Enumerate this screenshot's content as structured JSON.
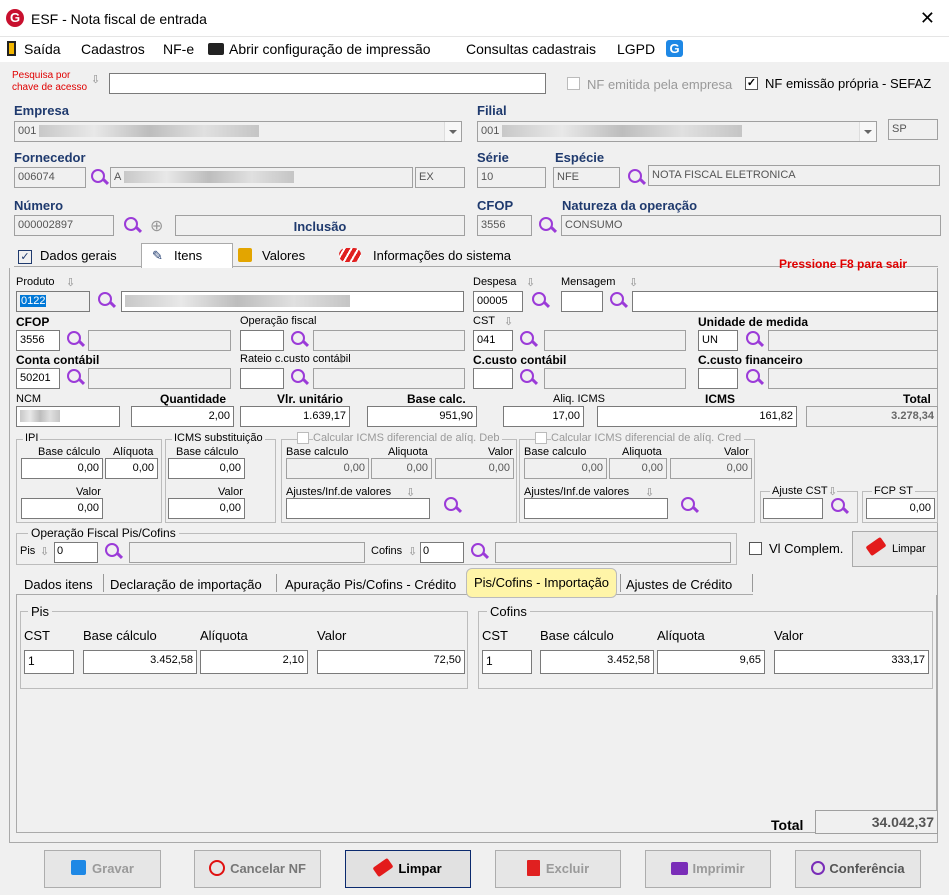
{
  "window": {
    "title": "ESF - Nota fiscal de entrada",
    "close": "✕",
    "app_icon": "G"
  },
  "menu": {
    "saida": "Saída",
    "cadastros": "Cadastros",
    "nfe": "NF-e",
    "abrir_config": "Abrir configuração de impressão",
    "consultas": "Consultas cadastrais",
    "lgpd": "LGPD"
  },
  "search": {
    "label_line1": "Pesquisa por",
    "label_line2": "chave de acesso",
    "value": ""
  },
  "flags": {
    "nf_emitida_label": "NF emitida pela empresa",
    "nf_emitida_checked": false,
    "nf_propria_label": "NF emissão própria - SEFAZ",
    "nf_propria_checked": true
  },
  "empresa": {
    "label": "Empresa",
    "code": "001"
  },
  "filial": {
    "label": "Filial",
    "code": "001",
    "uf": "SP"
  },
  "fornecedor": {
    "label": "Fornecedor",
    "code": "006074",
    "prefix": "A",
    "uf": "EX"
  },
  "serie": {
    "label": "Série",
    "value": "10"
  },
  "especie": {
    "label": "Espécie",
    "value": "NFE",
    "descricao": "NOTA FISCAL ELETRONICA"
  },
  "numero": {
    "label": "Número",
    "value": "000002897",
    "status": "Inclusão"
  },
  "cfop_head": {
    "label": "CFOP",
    "value": "3556"
  },
  "natureza": {
    "label": "Natureza da operação",
    "value": "CONSUMO"
  },
  "main_tabs": [
    {
      "label": "Dados gerais"
    },
    {
      "label": "Itens"
    },
    {
      "label": "Valores"
    },
    {
      "label": "Informações do sistema"
    }
  ],
  "hint": "Pressione F8 para sair",
  "item": {
    "produto_label": "Produto",
    "produto_code": "0122",
    "despesa_label": "Despesa",
    "despesa_value": "00005",
    "mensagem_label": "Mensagem",
    "mensagem_value": "",
    "cfop_label": "CFOP",
    "cfop_value": "3556",
    "operacao_label": "Operação fiscal",
    "operacao_value": "",
    "cst_label": "CST",
    "cst_value": "041",
    "unidade_label": "Unidade de medida",
    "unidade_value": "UN",
    "conta_label": "Conta contábil",
    "conta_value": "50201",
    "rateio_label": "Rateio c.custo contábil",
    "ccusto_label": "C.custo contábil",
    "ccusto_fin_label": "C.custo financeiro",
    "ncm_label": "NCM",
    "quantidade_label": "Quantidade",
    "quantidade_value": "2,00",
    "vlr_unit_label": "Vlr. unitário",
    "vlr_unit_value": "1.639,17",
    "base_label": "Base calc.",
    "base_value": "951,90",
    "aliq_icms_label": "Aliq. ICMS",
    "aliq_icms_value": "17,00",
    "icms_label": "ICMS",
    "icms_value": "161,82",
    "total_label": "Total",
    "total_value": "3.278,34"
  },
  "ipi": {
    "title": "IPI",
    "base_label": "Base cálculo",
    "base_value": "0,00",
    "aliq_label": "Alíquota",
    "aliq_value": "0,00",
    "valor_label": "Valor",
    "valor_value": "0,00"
  },
  "icms_st": {
    "title": "ICMS substituição",
    "base_label": "Base cálculo",
    "base_value": "0,00",
    "valor_label": "Valor",
    "valor_value": "0,00"
  },
  "difal_deb": {
    "title": "Calcular ICMS diferencial de alíq. Deb",
    "base_label": "Base calculo",
    "base_value": "0,00",
    "aliq_label": "Aliquota",
    "aliq_value": "0,00",
    "valor_label": "Valor",
    "valor_value": "0,00",
    "ajustes_label": "Ajustes/Inf.de valores"
  },
  "difal_cred": {
    "title": "Calcular ICMS diferencial de alíq. Cred",
    "base_label": "Base calculo",
    "base_value": "0,00",
    "aliq_label": "Aliquota",
    "aliq_value": "0,00",
    "valor_label": "Valor",
    "valor_value": "0,00",
    "ajustes_label": "Ajustes/Inf.de valores"
  },
  "ajuste_cst": {
    "title": "Ajuste CST"
  },
  "fcp_st": {
    "title": "FCP ST",
    "value": "0,00"
  },
  "pis_cofins": {
    "title": "Operação Fiscal Pis/Cofins",
    "pis_label": "Pis",
    "pis_value": "0",
    "cofins_label": "Cofins",
    "cofins_value": "0"
  },
  "vl_complem": {
    "label": "Vl Complem.",
    "checked": false
  },
  "limpar_small": "Limpar",
  "sub_tabs": [
    {
      "label": "Dados itens"
    },
    {
      "label": "Declaração de importação"
    },
    {
      "label": "Apuração Pis/Cofins - Crédito"
    },
    {
      "label": "Pis/Cofins - Importação"
    },
    {
      "label": "Ajustes de Crédito"
    }
  ],
  "pis_imp": {
    "title": "Pis",
    "cst_label": "CST",
    "cst_value": "1",
    "base_label": "Base cálculo",
    "base_value": "3.452,58",
    "aliq_label": "Alíquota",
    "aliq_value": "2,10",
    "valor_label": "Valor",
    "valor_value": "72,50"
  },
  "cofins_imp": {
    "title": "Cofins",
    "cst_label": "CST",
    "cst_value": "1",
    "base_label": "Base cálculo",
    "base_value": "3.452,58",
    "aliq_label": "Alíquota",
    "aliq_value": "9,65",
    "valor_label": "Valor",
    "valor_value": "333,17"
  },
  "grand_total": {
    "label": "Total",
    "value": "34.042,37"
  },
  "buttons": {
    "gravar": "Gravar",
    "cancelar": "Cancelar NF",
    "limpar": "Limpar",
    "excluir": "Excluir",
    "imprimir": "Imprimir",
    "conferencia": "Conferência"
  },
  "colors": {
    "accent_header": "#1f3a6e",
    "hint_red": "#e00000",
    "magnifier": "#9b3bd8",
    "tab_highlight": "#fff5a8"
  }
}
